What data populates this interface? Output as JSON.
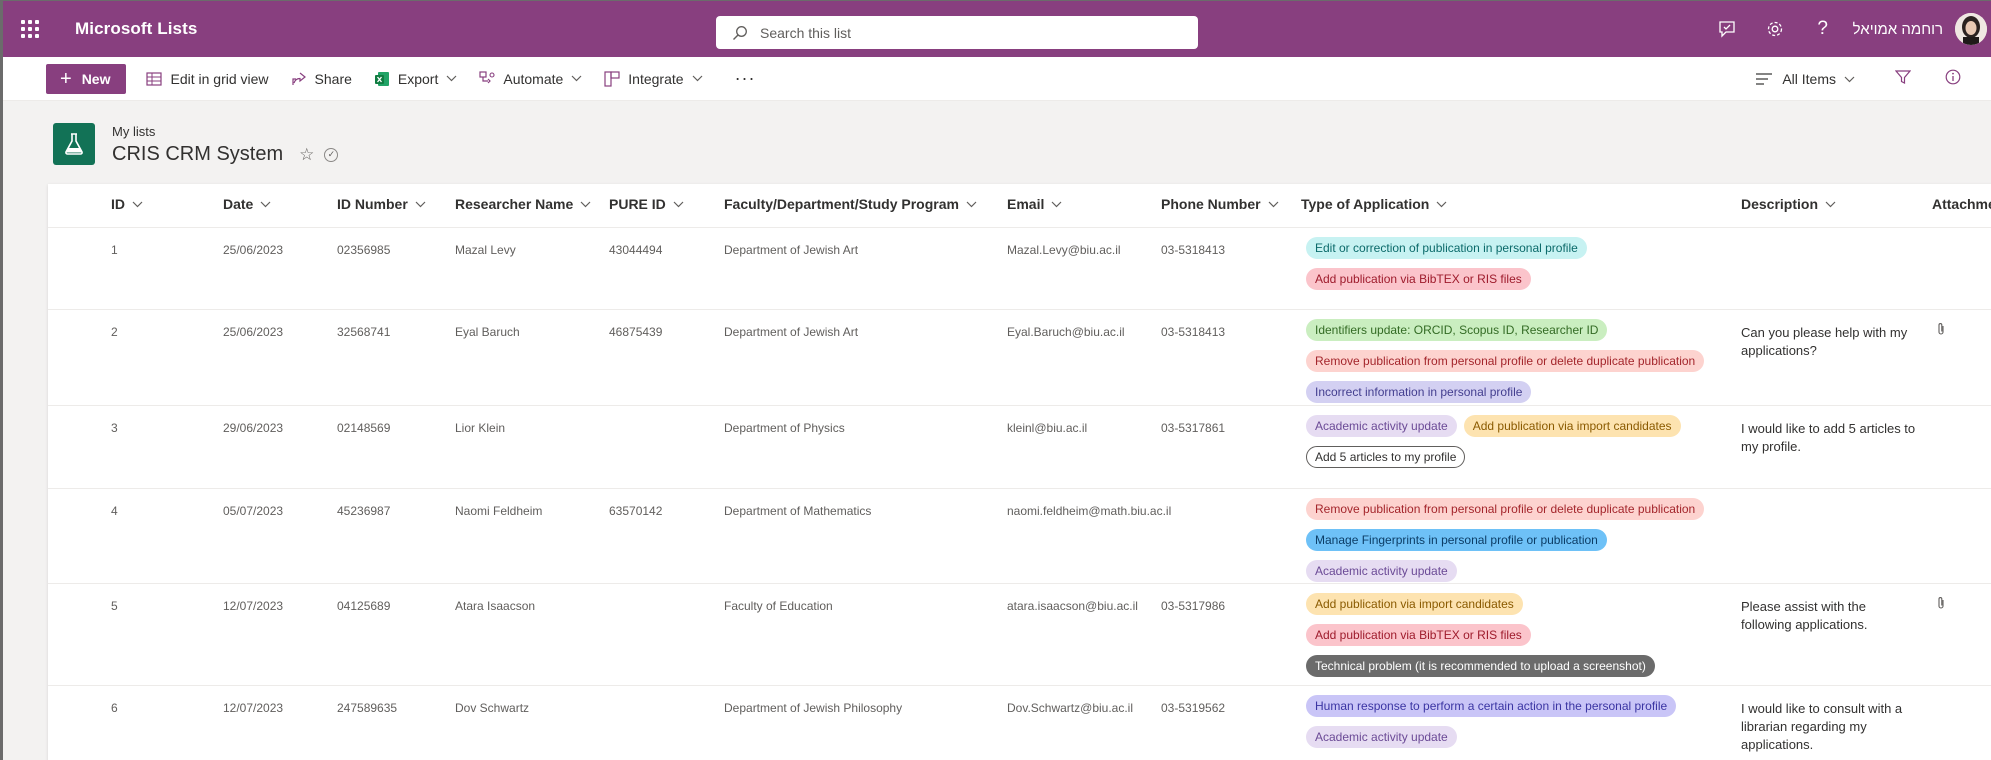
{
  "suitebar": {
    "app_title": "Microsoft Lists",
    "search_placeholder": "Search this list",
    "user_name": "רוחמה אמויאל"
  },
  "toolbar": {
    "new_label": "New",
    "grid_view_label": "Edit in grid view",
    "share_label": "Share",
    "export_label": "Export",
    "automate_label": "Automate",
    "integrate_label": "Integrate",
    "more_label": "···",
    "view_label": "All Items"
  },
  "list": {
    "breadcrumb": "My lists",
    "title": "CRIS CRM System"
  },
  "columns": [
    "ID",
    "Date",
    "ID Number",
    "Researcher Name",
    "PURE ID",
    "Faculty/Department/Study Program",
    "Email",
    "Phone Number",
    "Type of Application",
    "Description",
    "Attachme"
  ],
  "rows": [
    {
      "id": "1",
      "date": "25/06/2023",
      "id_number": "02356985",
      "name": "Mazal Levy",
      "pure_id": "43044494",
      "department": "Department of Jewish Art",
      "email": "Mazal.Levy@biu.ac.il",
      "phone": "03-5318413",
      "types": [
        {
          "label": "Edit or correction of publication in personal profile",
          "bg": "#c7f2f2",
          "fg": "#0b6a6a"
        },
        {
          "label": "Add publication via BibTEX or RIS files",
          "bg": "#fbc4cb",
          "fg": "#9e1b2c"
        }
      ],
      "description": "",
      "attachment": false
    },
    {
      "id": "2",
      "date": "25/06/2023",
      "id_number": "32568741",
      "name": "Eyal Baruch",
      "pure_id": "46875439",
      "department": "Department of Jewish Art",
      "email": "Eyal.Baruch@biu.ac.il",
      "phone": "03-5318413",
      "types": [
        {
          "label": "Identifiers update: ORCID, Scopus ID, Researcher ID",
          "bg": "#caeec0",
          "fg": "#336b24"
        },
        {
          "label": "Remove publication from personal profile or delete duplicate publication",
          "bg": "#fdd3cf",
          "fg": "#a4262c"
        },
        {
          "label": "Incorrect information in personal profile",
          "bg": "#d3d0f2",
          "fg": "#433e8f"
        }
      ],
      "description": "Can you please help with my applications?",
      "attachment": true
    },
    {
      "id": "3",
      "date": "29/06/2023",
      "id_number": "02148569",
      "name": "Lior Klein",
      "pure_id": "",
      "department": "Department of Physics",
      "email": "kleinl@biu.ac.il",
      "phone": "03-5317861",
      "types": [
        {
          "label": "Academic activity update",
          "bg": "#e6dcf2",
          "fg": "#6b4a96"
        },
        {
          "label": "Add publication via import candidates",
          "bg": "#fde3b0",
          "fg": "#8a5a00"
        },
        {
          "label": "Add 5 articles to my profile",
          "bg": "#ffffff",
          "fg": "#323130",
          "border": "#605e5c"
        }
      ],
      "description": "I would like to add 5 articles to my profile.",
      "attachment": false
    },
    {
      "id": "4",
      "date": "05/07/2023",
      "id_number": "45236987",
      "name": "Naomi Feldheim",
      "pure_id": "63570142",
      "department": "Department of Mathematics",
      "email": "naomi.feldheim@math.biu.ac.il",
      "phone": "",
      "types": [
        {
          "label": "Remove publication from personal profile or delete duplicate publication",
          "bg": "#fdd3cf",
          "fg": "#a4262c"
        },
        {
          "label": "Manage Fingerprints in personal profile or publication",
          "bg": "#6ec1f7",
          "fg": "#0c3d66"
        },
        {
          "label": "Academic activity update",
          "bg": "#e6dcf2",
          "fg": "#6b4a96"
        }
      ],
      "description": "",
      "attachment": false
    },
    {
      "id": "5",
      "date": "12/07/2023",
      "id_number": "04125689",
      "name": "Atara Isaacson",
      "pure_id": "",
      "department": "Faculty of Education",
      "email": "atara.isaacson@biu.ac.il",
      "phone": "03-5317986",
      "types": [
        {
          "label": "Add publication via import candidates",
          "bg": "#fde3b0",
          "fg": "#8a5a00"
        },
        {
          "label": "Add publication via BibTEX or RIS files",
          "bg": "#fbc4cb",
          "fg": "#9e1b2c"
        },
        {
          "label": "Technical problem (it is recommended to upload a screenshot)",
          "bg": "#6b6b6b",
          "fg": "#ffffff"
        }
      ],
      "description": "Please assist with the following applications.",
      "attachment": true
    },
    {
      "id": "6",
      "date": "12/07/2023",
      "id_number": "247589635",
      "name": "Dov Schwartz",
      "pure_id": "",
      "department": "Department of Jewish Philosophy",
      "email": "Dov.Schwartz@biu.ac.il",
      "phone": "03-5319562",
      "types": [
        {
          "label": "Human response to perform a certain action in the personal profile",
          "bg": "#c9c5f7",
          "fg": "#3b35a3"
        },
        {
          "label": "Academic activity update",
          "bg": "#e6dcf2",
          "fg": "#6b4a96"
        }
      ],
      "description": "I would like to consult with a librarian regarding my applications.",
      "attachment": false
    }
  ],
  "colors": {
    "suitebar": "#883f7f",
    "list_icon": "#127256"
  }
}
